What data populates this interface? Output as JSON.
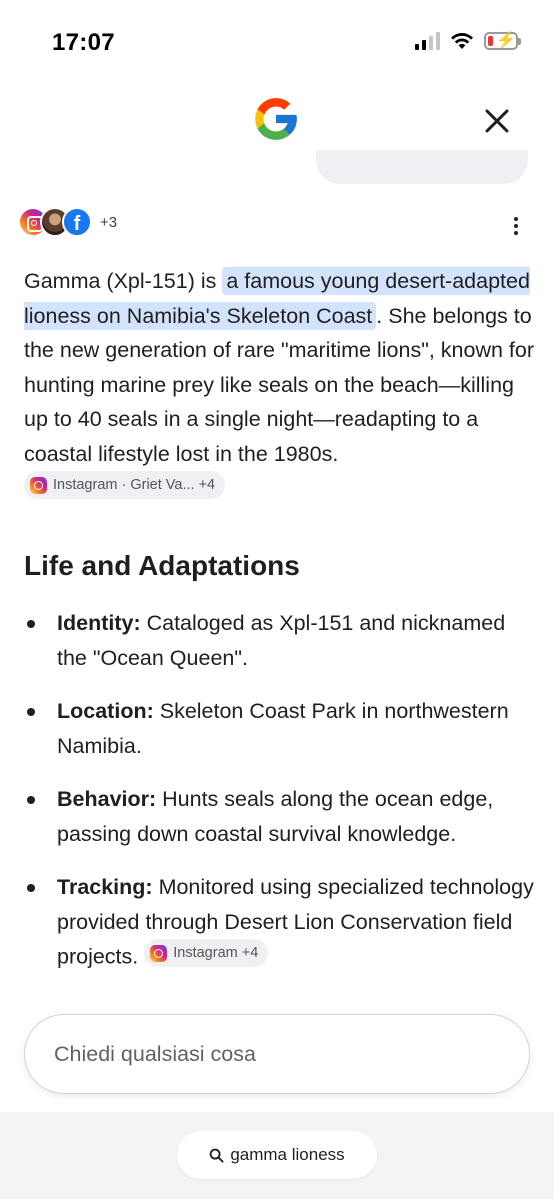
{
  "status_bar": {
    "time": "17:07",
    "battery_level": 0.2,
    "charging": true
  },
  "header": {
    "logo_icon": "google-g-icon",
    "close_icon": "close-icon"
  },
  "sources": {
    "count_label": "+3",
    "icons": [
      "instagram-icon",
      "profile-photo",
      "facebook-icon"
    ]
  },
  "answer": {
    "intro_before": "Gamma (Xpl-151) is ",
    "intro_highlight": "a famous young desert-adapted lioness on Namibia's Skeleton Coast",
    "intro_after": ". She belongs to the new generation of rare \"maritime lions\", known for hunting marine prey like seals on the beach—killing up to 40 seals in a single night—readapting to a coastal lifestyle lost in the 1980s.",
    "intro_chip": "Instagram · Griet Va... +4"
  },
  "section": {
    "title": "Life and Adaptations",
    "bullets": [
      {
        "label": "Identity:",
        "text": " Cataloged as Xpl-151 and nicknamed the \"Ocean Queen\"."
      },
      {
        "label": "Location:",
        "text": " Skeleton Coast Park in northwestern Namibia."
      },
      {
        "label": "Behavior:",
        "text": " Hunts seals along the ocean edge, passing down coastal survival knowledge."
      },
      {
        "label": "Tracking:",
        "text": " Monitored using specialized technology provided through Desert Lion Conservation field projects.",
        "chip": "Instagram +4"
      }
    ]
  },
  "input": {
    "placeholder": "Chiedi qualsiasi cosa"
  },
  "bottom": {
    "search_label": "gamma lioness"
  },
  "colors": {
    "highlight": "#d3e3fd",
    "chip_bg": "#eef0f4",
    "bottom_bar": "#f3f4f6"
  }
}
